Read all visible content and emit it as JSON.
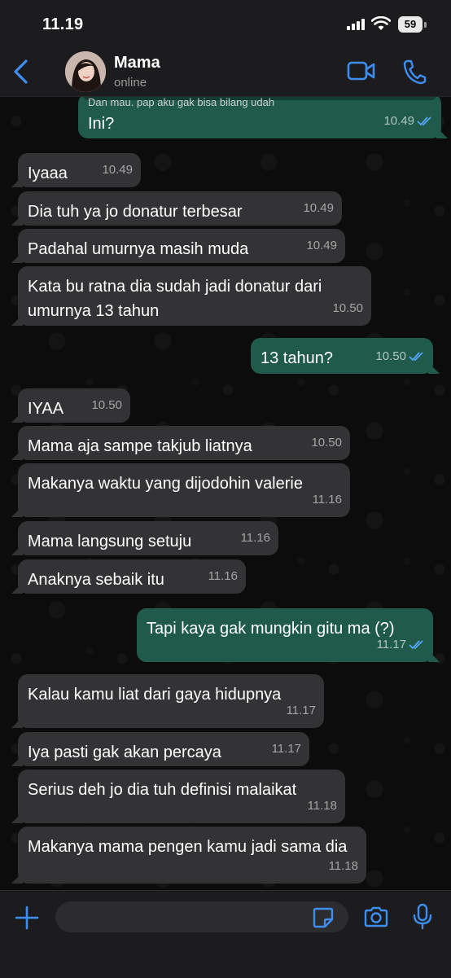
{
  "status_bar": {
    "time": "11.19",
    "battery": "59"
  },
  "header": {
    "name": "Mama",
    "status": "online"
  },
  "quoted_text": "Dan mau. pap aku gak bisa bilang udah",
  "messages": [
    {
      "dir": "out",
      "text": "Ini?",
      "time": "10.49",
      "read": true
    },
    {
      "dir": "in",
      "text": "Iyaaa",
      "time": "10.49"
    },
    {
      "dir": "in",
      "text": "Dia tuh ya jo donatur terbesar",
      "time": "10.49"
    },
    {
      "dir": "in",
      "text": "Padahal umurnya masih muda",
      "time": "10.49"
    },
    {
      "dir": "in",
      "text": "Kata bu ratna dia sudah jadi donatur dari umurnya 13 tahun",
      "time": "10.50"
    },
    {
      "dir": "out",
      "text": "13 tahun?",
      "time": "10.50",
      "read": true
    },
    {
      "dir": "in",
      "text": "IYAA",
      "time": "10.50"
    },
    {
      "dir": "in",
      "text": "Mama aja sampe takjub liatnya",
      "time": "10.50"
    },
    {
      "dir": "in",
      "text": "Makanya waktu yang dijodohin valerie",
      "time": "11.16"
    },
    {
      "dir": "in",
      "text": "Mama langsung setuju",
      "time": "11.16"
    },
    {
      "dir": "in",
      "text": "Anaknya sebaik itu",
      "time": "11.16"
    },
    {
      "dir": "out",
      "text": "Tapi kaya gak mungkin gitu ma (?)",
      "time": "11.17",
      "read": true
    },
    {
      "dir": "in",
      "text": "Kalau kamu liat dari gaya hidupnya",
      "time": "11.17"
    },
    {
      "dir": "in",
      "text": "Iya pasti gak akan percaya",
      "time": "11.17"
    },
    {
      "dir": "in",
      "text": "Serius deh jo dia tuh definisi malaikat",
      "time": "11.18"
    },
    {
      "dir": "in",
      "text": "Makanya mama pengen kamu jadi sama dia",
      "time": "11.18"
    }
  ],
  "composer": {
    "placeholder": ""
  },
  "icons": {
    "back": "chevron-left-icon",
    "video": "video-camera-icon",
    "phone": "phone-icon",
    "plus": "plus-icon",
    "sticker": "sticker-icon",
    "camera": "camera-icon",
    "mic": "microphone-icon",
    "read": "double-check-icon"
  },
  "colors": {
    "accent": "#3d8ef0",
    "outgoing_bubble": "#1f5a4a",
    "incoming_bubble": "#333335",
    "read_ticks": "#53a6f5",
    "bar_background": "#1c1c1e"
  }
}
